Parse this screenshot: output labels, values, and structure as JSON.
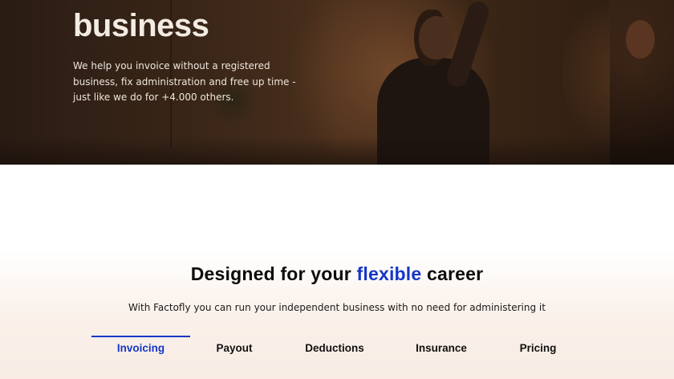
{
  "hero": {
    "title": "business",
    "text": "We help you invoice without a registered business, fix administration and free up time - just like we do for +4.000 others."
  },
  "features": {
    "title_before": "Designed for your ",
    "title_accent": "flexible",
    "title_after": " career",
    "subtitle": "With Factofly you can run your independent business with no need for administering it",
    "tabs": [
      {
        "label": "Invoicing",
        "active": true
      },
      {
        "label": "Payout",
        "active": false
      },
      {
        "label": "Deductions",
        "active": false
      },
      {
        "label": "Insurance",
        "active": false
      },
      {
        "label": "Pricing",
        "active": false
      }
    ]
  },
  "colors": {
    "accent": "#1537c7",
    "hero_text": "#f3ece3",
    "section_bg_bottom": "#f8ece4"
  }
}
